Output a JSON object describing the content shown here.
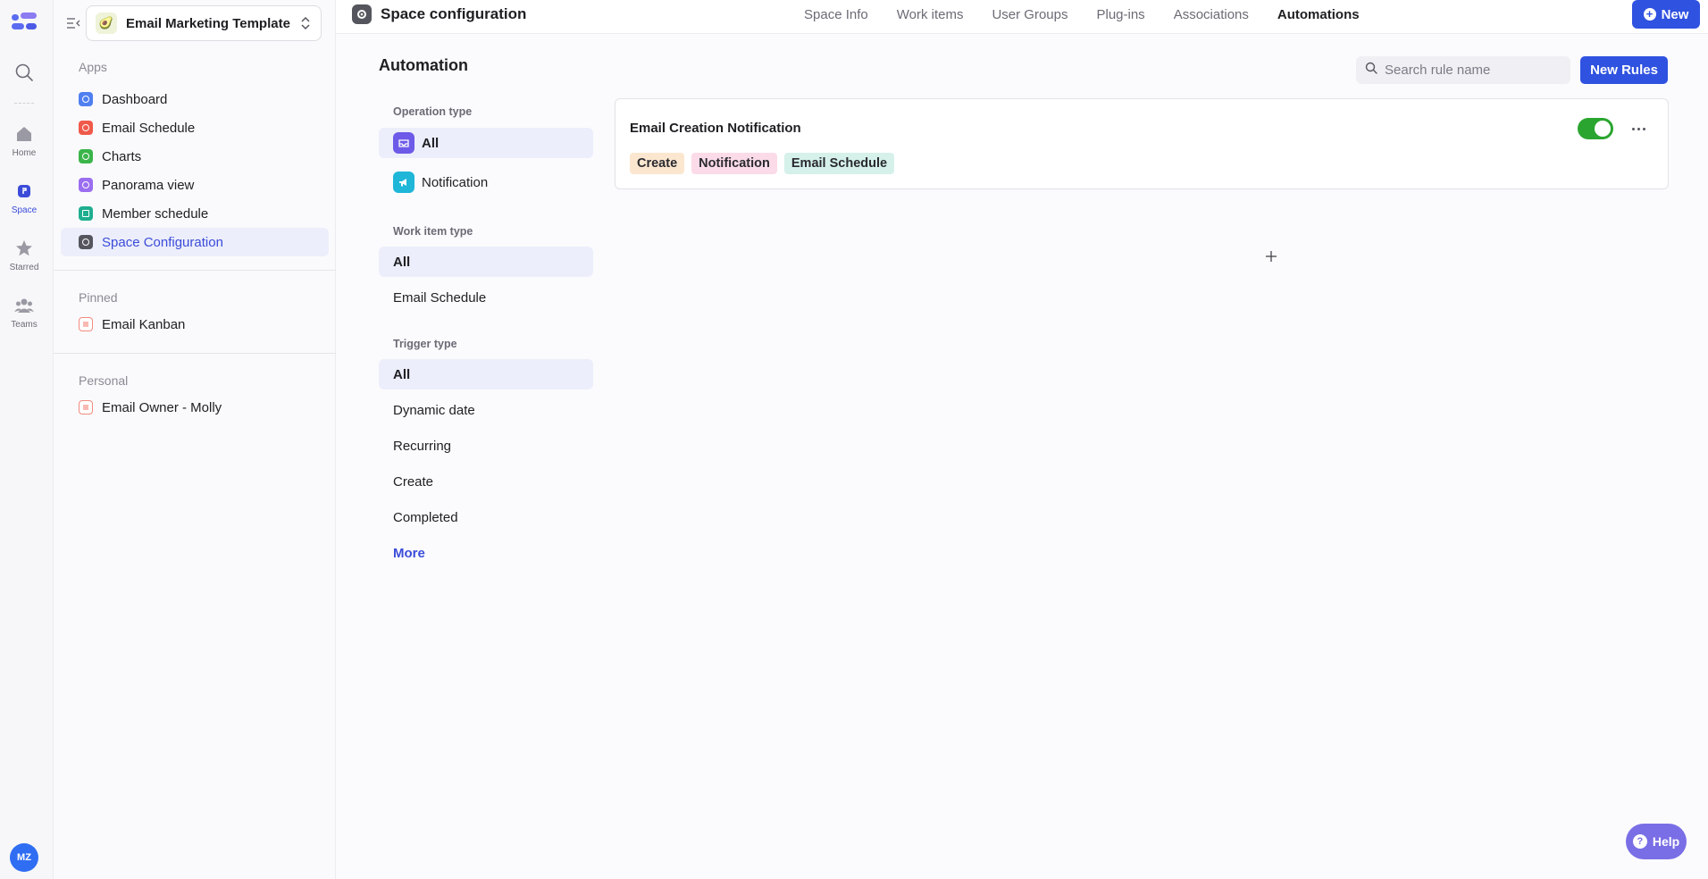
{
  "rail": {
    "items": [
      {
        "label": "Home"
      },
      {
        "label": "Space"
      },
      {
        "label": "Starred"
      },
      {
        "label": "Teams"
      }
    ],
    "avatar_initials": "MZ",
    "accent": "#3b4cd9"
  },
  "sidebar": {
    "workspace_name": "Email Marketing Template",
    "workspace_emoji": "🥑",
    "sections": {
      "apps_label": "Apps",
      "pinned_label": "Pinned",
      "personal_label": "Personal"
    },
    "apps": [
      {
        "label": "Dashboard",
        "icon": "dashboard-icon",
        "color": "#4f7ff0"
      },
      {
        "label": "Email Schedule",
        "icon": "schedule-icon",
        "color": "#ef5a4a"
      },
      {
        "label": "Charts",
        "icon": "charts-icon",
        "color": "#3bb54a"
      },
      {
        "label": "Panorama view",
        "icon": "panorama-icon",
        "color": "#9b6ef0"
      },
      {
        "label": "Member schedule",
        "icon": "member-schedule-icon",
        "color": "#1fae8f"
      },
      {
        "label": "Space Configuration",
        "icon": "gear-icon",
        "color": "#55555d"
      }
    ],
    "pinned": [
      {
        "label": "Email Kanban",
        "icon": "list-icon",
        "color": "#f28a7e"
      }
    ],
    "personal": [
      {
        "label": "Email Owner - Molly",
        "icon": "list-icon",
        "color": "#f28a7e"
      }
    ]
  },
  "topbar": {
    "title": "Space configuration",
    "tabs": [
      "Space Info",
      "Work items",
      "User Groups",
      "Plug-ins",
      "Associations",
      "Automations"
    ],
    "active_tab": "Automations",
    "new_label": "New"
  },
  "automation": {
    "title": "Automation",
    "search_placeholder": "Search rule name",
    "new_rules_label": "New Rules",
    "operation_type": {
      "label": "Operation type",
      "items": [
        "All",
        "Notification"
      ]
    },
    "work_item_type": {
      "label": "Work item type",
      "items": [
        "All",
        "Email Schedule"
      ]
    },
    "trigger_type": {
      "label": "Trigger type",
      "items": [
        "All",
        "Dynamic date",
        "Recurring",
        "Create",
        "Completed"
      ],
      "more_label": "More"
    },
    "rules": [
      {
        "name": "Email Creation Notification",
        "enabled": true,
        "tags": [
          "Create",
          "Notification",
          "Email Schedule"
        ]
      }
    ]
  },
  "help_label": "Help"
}
